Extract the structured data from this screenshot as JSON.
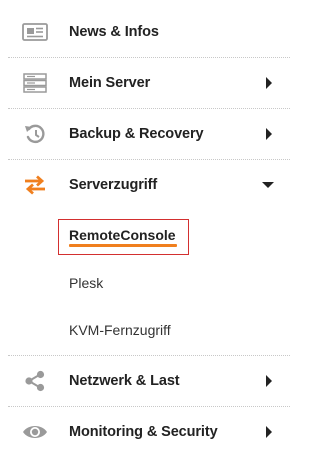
{
  "menu": {
    "items": [
      {
        "label": "News & Infos",
        "icon": "newspaper-icon"
      },
      {
        "label": "Mein Server",
        "icon": "server-rack-icon",
        "arrow": "chevron-right-icon"
      },
      {
        "label": "Backup & Recovery",
        "icon": "restore-icon",
        "arrow": "chevron-right-icon"
      },
      {
        "label": "Serverzugriff",
        "icon": "transfer-arrows-icon",
        "arrow": "chevron-down-icon"
      },
      {
        "label": "Netzwerk & Last",
        "icon": "share-icon",
        "arrow": "chevron-right-icon"
      },
      {
        "label": "Monitoring & Security",
        "icon": "eye-icon",
        "arrow": "chevron-right-icon"
      }
    ],
    "subitems": [
      {
        "label": "RemoteConsole",
        "active": true
      },
      {
        "label": "Plesk"
      },
      {
        "label": "KVM-Fernzugriff"
      }
    ]
  },
  "colors": {
    "accent_orange": "#f07f1e",
    "highlight_red": "#d32f2f",
    "icon_gray": "#9a9a9a",
    "text": "#222222"
  }
}
